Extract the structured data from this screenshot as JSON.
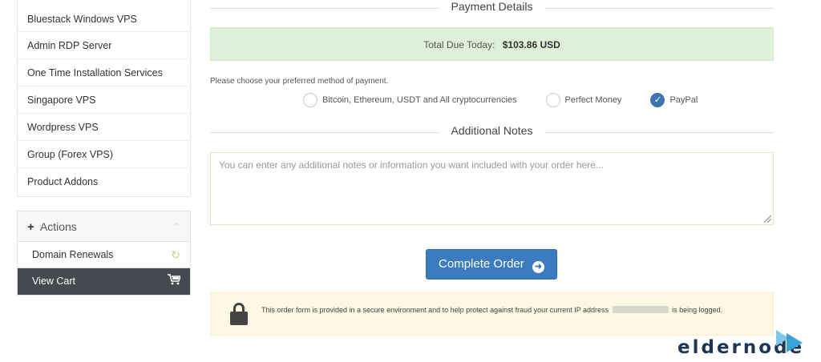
{
  "sidebar": {
    "items": [
      {
        "label": "Bluestack Windows VPS"
      },
      {
        "label": "Admin RDP Server"
      },
      {
        "label": "One Time Installation Services"
      },
      {
        "label": "Singapore VPS"
      },
      {
        "label": "Wordpress VPS"
      },
      {
        "label": "Group (Forex VPS)"
      },
      {
        "label": "Product Addons"
      }
    ],
    "actions": {
      "title": "Actions",
      "items": [
        {
          "label": "Domain Renewals",
          "icon": "refresh-icon"
        },
        {
          "label": "View Cart",
          "icon": "cart-icon"
        }
      ]
    }
  },
  "payment": {
    "section_title": "Payment Details",
    "total_label": "Total Due Today:",
    "total_value": "$103.86 USD",
    "choose_text": "Please choose your preferred method of payment.",
    "options": [
      {
        "label": "Bitcoin, Ethereum, USDT and All cryptocurrencies",
        "checked": false
      },
      {
        "label": "Perfect Money",
        "checked": false
      },
      {
        "label": "PayPal",
        "checked": true
      }
    ]
  },
  "notes": {
    "section_title": "Additional Notes",
    "placeholder": "You can enter any additional notes or information you want included with your order here..."
  },
  "checkout": {
    "button_label": "Complete Order",
    "secure_text_before": "This order form is provided in a secure environment and to help protect against fraud your current IP address",
    "secure_text_after": "is being logged."
  },
  "logo": {
    "text": "eldernode"
  },
  "colors": {
    "accent": "#3b7bbf",
    "success_bg": "#dff0d8",
    "warning_bg": "#fcf8e3",
    "dark_item": "#444a4f"
  }
}
